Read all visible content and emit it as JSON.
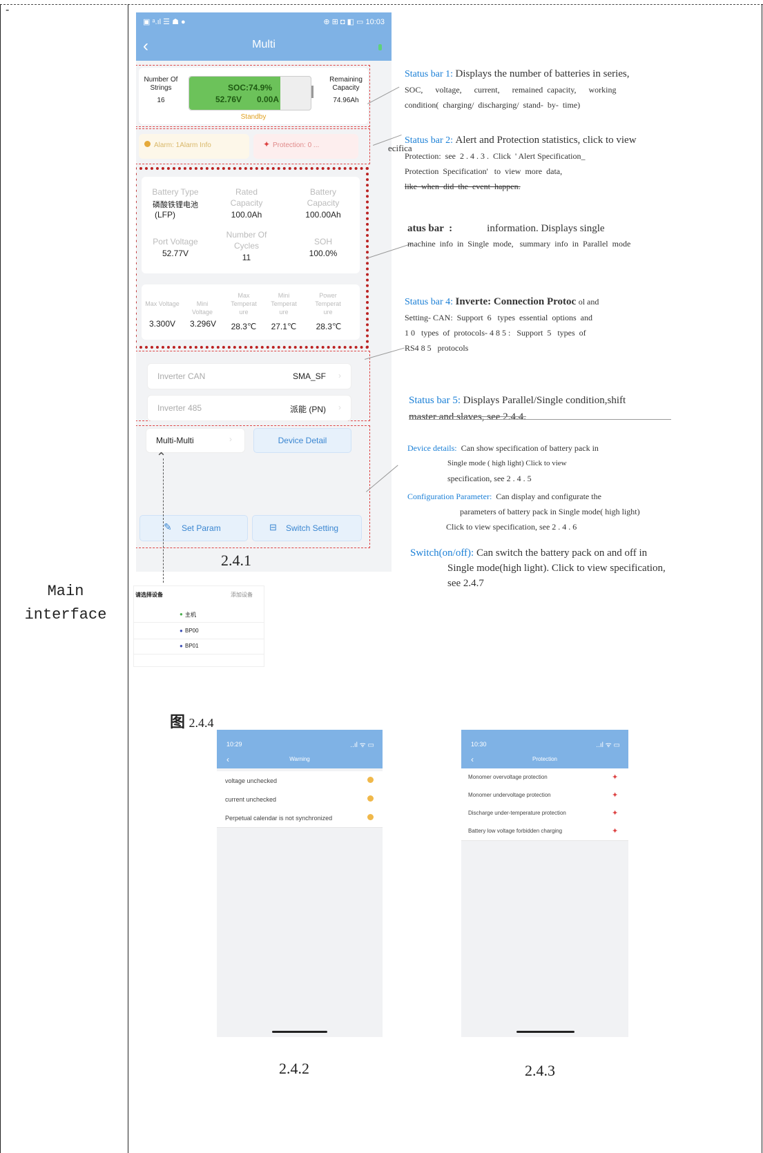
{
  "page": {
    "dash_mark": "-",
    "left_label": "Main\ninterface"
  },
  "phone": {
    "statusbar_left": "▣ ᵃ.ıl ☰ ☗ ●",
    "statusbar_right": "⊕ ⊞ ◘ ◧ ▭ 10:03",
    "nav_back": "‹",
    "nav_title": "Multi",
    "strings_label": "Number Of Strings",
    "strings_value": "16",
    "soc": "SOC:74.9%",
    "voltage": "52.76V",
    "current": "0.00A",
    "soc_fraction": 0.749,
    "remaining_label": "Remaining Capacity",
    "remaining_value": "74.96Ah",
    "state": "Standby",
    "alarm": "Alarm: 1Alarm Info",
    "protection": "Protection: 0 ...",
    "battery_type_label": "Battery Type",
    "battery_type_value": "磷酸铁锂电池",
    "battery_type_sub": "(LFP)",
    "rated_label": "Rated Capacity",
    "rated_value": "100.0Ah",
    "battcap_label": "Battery Capacity",
    "battcap_value": "100.00Ah",
    "port_label": "Port Voltage",
    "port_value": "52.77V",
    "cycles_label": "Number Of Cycles",
    "cycles_value": "11",
    "soh_label": "SOH",
    "soh_value": "100.0%",
    "maxv_label": "Max Voltage",
    "maxv_value": "3.300V",
    "minv_label": "Mini Voltage",
    "minv_value": "3.296V",
    "maxt_label": "Max Temperat ure",
    "maxt_value": "28.3℃",
    "mint_label": "Mini Temperat ure",
    "mint_value": "27.1℃",
    "powt_label": "Power Temperat ure",
    "powt_value": "28.3℃",
    "inv_can_label": "Inverter CAN",
    "inv_can_value": "SMA_SF",
    "inv_485_label": "Inverter 485",
    "inv_485_value": "派能 (PN)",
    "multi_button": "Multi-Multi",
    "device_detail": "Device Detail",
    "set_param": "Set Param",
    "switch_setting": "Switch Setting"
  },
  "captions": {
    "fig_241": "2.4.1",
    "fig_244_prefix": "图",
    "fig_244": "2.4.4",
    "fig_242": "2.4.2",
    "fig_243": "2.4.3"
  },
  "annotations": {
    "s1_title": "Status bar 1:",
    "s1_line1": "Displays the number of batteries in series,",
    "s1_line2": "SOC,      voltage,      current,      remained  capacity,      working",
    "s1_line3": "condition(  charging/  discharging/  stand-  by-  time)",
    "s2_title": "Status bar 2:",
    "s2_prefix": "ecifica",
    "s2_line1": "Alert and Protection statistics, click to view",
    "s2_line2": "Protection:  see  2 . 4 . 3 .  Click  ' Alert Specification_",
    "s2_line3": "Protection  Specification'   to  view  more  data,",
    "s2_line4": "like  when  did  the  event  happen.",
    "s3_title": "atus bar  :",
    "s3_line1": "information. Displays single",
    "s3_line2": "machine  info  in  Single  mode,   summary  info  in  Parallel  mode",
    "s4_title": "Status bar 4:",
    "s4_line1": "Inverte: Connection Protoc",
    "s4_line1b": "ol and",
    "s4_line2": "Setting- CAN:  Support  6   types  essential  options  and",
    "s4_line3": "1 0   types  of  protocols- 4 8 5 :   Support  5   types  of",
    "s4_line4": "RS4 8 5   protocols",
    "s5_title": "Status bar 5:",
    "s5_line1": "Displays Parallel/Single condition,shift",
    "s5_line2": "master and slaves, see 2.4.4.",
    "dd_title": "Device  details:",
    "dd_line1": "Can  show  specification  of  battery  pack  in",
    "dd_line2": "Single   mode   (  high   light)      Click   to   view",
    "dd_line3": "specification,  see  2 . 4 . 5",
    "cp_title": "Configuration  Parameter:",
    "cp_line1": "Can  display  and  configurate  the",
    "cp_line2": "parameters  of  battery  pack  in  Single  mode( high  light)",
    "cp_line3": "Click  to  view  specification,  see  2 . 4 . 6",
    "sw_title": "Switch(on/off):",
    "sw_line1": "Can switch the battery pack on and off in",
    "sw_line2": "Single mode(high light). Click to view specification,",
    "sw_line3": "see 2.4.7"
  },
  "device_select": {
    "title": "请选择设备",
    "right": "添加设备",
    "items": [
      "主机",
      "BP00",
      "BP01"
    ]
  },
  "warning_screen": {
    "time": "10:29",
    "signal": "..ıl ᯤ ▭",
    "title": "Warning",
    "rows": [
      "voltage unchecked",
      "current unchecked",
      "Perpetual calendar is not synchronized"
    ]
  },
  "protection_screen": {
    "time": "10:30",
    "signal": "..ıl ᯤ ▭",
    "title": "Protection",
    "rows": [
      "Monomer overvoltage protection",
      "Monomer undervoltage protection",
      "Discharge under-temperature protection",
      "Battery low voltage forbidden charging"
    ]
  },
  "colors": {
    "header_blue": "#7fb2e5",
    "soc_green": "#6cc25a",
    "annotation_blue": "#1a7fd6",
    "dash_red": "#dd4444"
  }
}
